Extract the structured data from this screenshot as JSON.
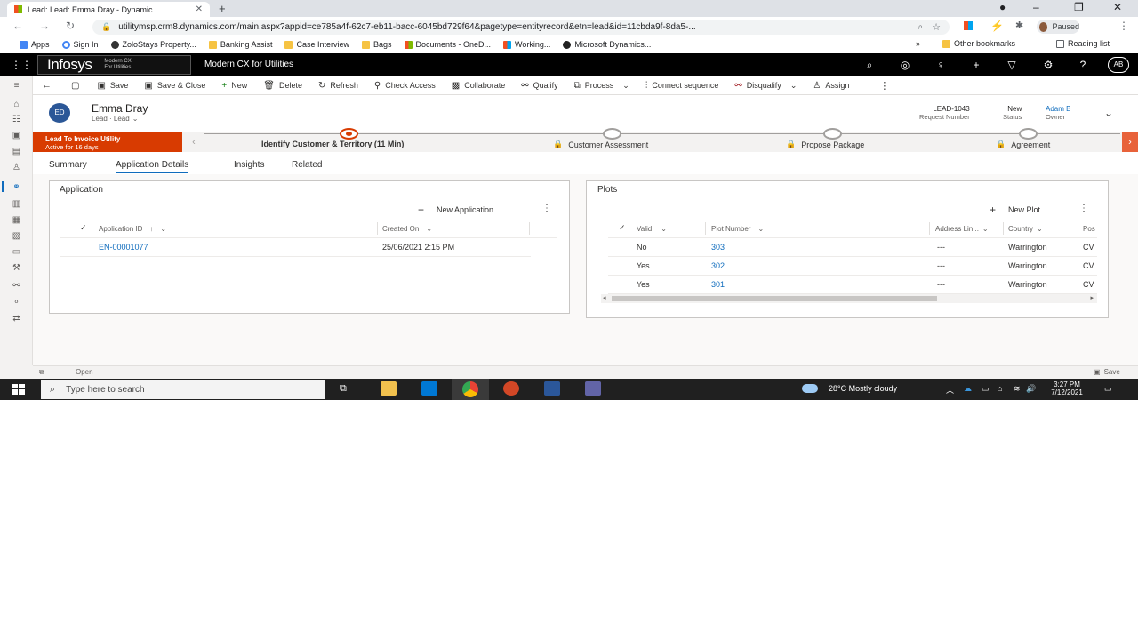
{
  "browser": {
    "tab_title": "Lead: Lead: Emma Dray - Dynamic",
    "url": "utilitymsp.crm8.dynamics.com/main.aspx?appid=ce785a4f-62c7-eb11-bacc-6045bd729f64&pagetype=entityrecord&etn=lead&id=11cbda9f-8da5-...",
    "profile_status": "Paused",
    "bookmarks": [
      "Apps",
      "Sign In",
      "ZoloStays Property...",
      "Banking Assist",
      "Case Interview",
      "Bags",
      "Documents - OneD...",
      "Working...",
      "Microsoft Dynamics..."
    ],
    "other_bookmarks": "Other bookmarks",
    "reading_list": "Reading list"
  },
  "app": {
    "logo_text": "Infosys",
    "logo_sub_1": "Modern CX",
    "logo_sub_2": "For Utilities",
    "title": "Modern CX for Utilities",
    "user_initials": "AB"
  },
  "commands": [
    "Save",
    "Save & Close",
    "New",
    "Delete",
    "Refresh",
    "Check Access",
    "Collaborate",
    "Qualify",
    "Process",
    "Connect sequence",
    "Disqualify",
    "Assign"
  ],
  "record": {
    "initials": "ED",
    "name": "Emma Dray",
    "subtitle": "Lead · Lead",
    "request_number": "LEAD-1043",
    "request_number_label": "Request Number",
    "status": "New",
    "status_label": "Status",
    "owner": "Adam B",
    "owner_label": "Owner"
  },
  "bpf": {
    "name": "Lead To Invoice Utility",
    "active_for": "Active for 16 days",
    "stages": [
      "Identify Customer & Territory  (11 Min)",
      "Customer Assessment",
      "Propose Package",
      "Agreement"
    ]
  },
  "form_tabs": [
    "Summary",
    "Application Details",
    "Insights",
    "Related"
  ],
  "application": {
    "title": "Application",
    "new_label": "New Application",
    "columns": [
      "Application ID",
      "Created On"
    ],
    "rows": [
      {
        "id": "EN-00001077",
        "created_on": "25/06/2021 2:15 PM"
      }
    ]
  },
  "plots": {
    "title": "Plots",
    "new_label": "New Plot",
    "columns": [
      "Valid",
      "Plot Number",
      "Address Lin...",
      "Country",
      "Pos"
    ],
    "rows": [
      {
        "valid": "No",
        "plot": "303",
        "address": "---",
        "country": "Warrington",
        "pos": "CV"
      },
      {
        "valid": "Yes",
        "plot": "302",
        "address": "---",
        "country": "Warrington",
        "pos": "CV"
      },
      {
        "valid": "Yes",
        "plot": "301",
        "address": "---",
        "country": "Warrington",
        "pos": "CV"
      }
    ]
  },
  "statusbar": {
    "left": "Open",
    "right": "Save"
  },
  "taskbar": {
    "search_placeholder": "Type here to search",
    "weather": "28°C  Mostly cloudy",
    "time": "3:27 PM",
    "date": "7/12/2021"
  },
  "colors": {
    "accent": "#0f6cbd",
    "bpf_active": "#d83b01",
    "header": "#000000"
  }
}
